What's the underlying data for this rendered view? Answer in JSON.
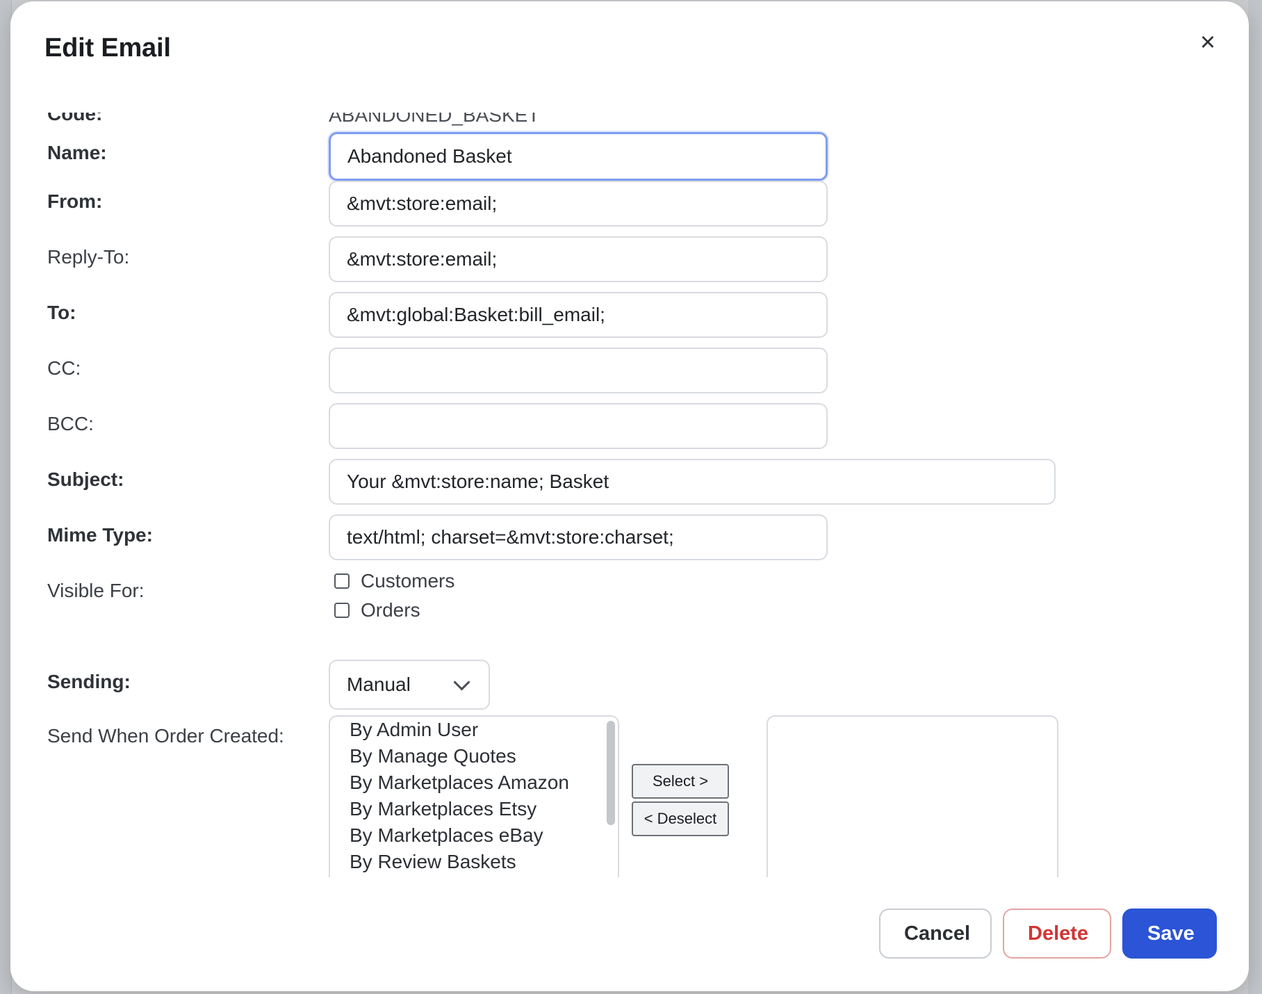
{
  "modal": {
    "title": "Edit Email",
    "close_label": "×"
  },
  "form": {
    "code": {
      "label": "Code:",
      "value": "ABANDONED_BASKET"
    },
    "name": {
      "label": "Name:",
      "value": "Abandoned Basket"
    },
    "from": {
      "label": "From:",
      "value": "&mvt:store:email;"
    },
    "reply_to": {
      "label": "Reply-To:",
      "value": "&mvt:store:email;"
    },
    "to": {
      "label": "To:",
      "value": "&mvt:global:Basket:bill_email;"
    },
    "cc": {
      "label": "CC:",
      "value": ""
    },
    "bcc": {
      "label": "BCC:",
      "value": ""
    },
    "subject": {
      "label": "Subject:",
      "value": "Your &mvt:store:name; Basket"
    },
    "mime_type": {
      "label": "Mime Type:",
      "value": "text/html; charset=&mvt:store:charset;"
    },
    "visible_for": {
      "label": "Visible For:",
      "options": [
        {
          "label": "Customers",
          "checked": false
        },
        {
          "label": "Orders",
          "checked": false
        }
      ]
    },
    "sending": {
      "label": "Sending:",
      "selected": "Manual"
    },
    "send_when": {
      "label": "Send When Order Created:",
      "available": [
        "By Admin User",
        "By Manage Quotes",
        "By Marketplaces Amazon",
        "By Marketplaces Etsy",
        "By Marketplaces eBay",
        "By Review Baskets"
      ],
      "selected": [],
      "select_label": "Select >",
      "deselect_label": "< Deselect"
    }
  },
  "footer": {
    "cancel_label": "Cancel",
    "delete_label": "Delete",
    "save_label": "Save"
  },
  "colors": {
    "primary": "#2b54d6",
    "danger": "#d13434",
    "focus_ring": "#7f9cf0"
  }
}
